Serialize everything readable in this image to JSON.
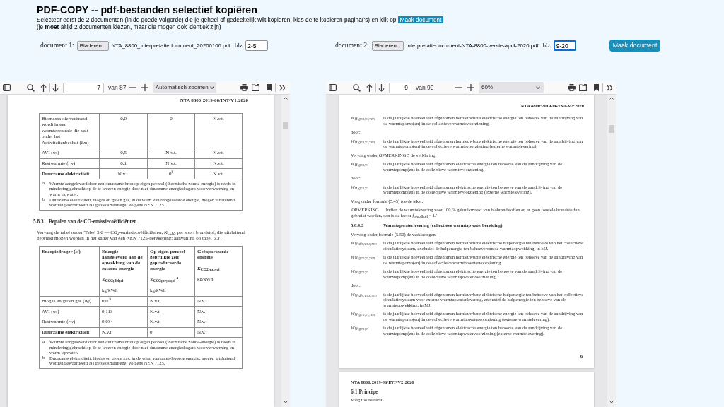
{
  "header": {
    "title": "PDF-COPY -- pdf-bestanden selectief kopiëren",
    "instruction": "Selecteer eerst de 2 documenten (in de goede volgorde) die je geheel of gedeeltelijk wilt kopiëren, kies de te kopiëren pagina('s) en klik op",
    "instruction_highlight": "Maak document",
    "note": "(je **moet** altijd 2 documenten kiezen, maar die mogen ook identiek zijn)"
  },
  "documents": [
    {
      "label": "document 1:",
      "browse_button": "Bladeren...",
      "filename": "NTA_8800_interpretatiedocument_20200106.pdf",
      "pages_label": "blz.",
      "pages": "2-5",
      "focused": false
    },
    {
      "label": "document 2:",
      "browse_button": "Bladeren...",
      "filename": "Interpretatiedocument-NTA-8800-versie-april-2020.pdf",
      "pages_label": "blz.",
      "pages": "9-20",
      "focused": true
    }
  ],
  "make_button": "Maak document",
  "viewers": [
    {
      "toolbar": {
        "page": "7",
        "page_count": "van 87",
        "zoom": "Automatisch zoomen"
      },
      "pages": [
        {
          "blocks": [
            {
              "kind": "running_header",
              "text": "NTA 8800:2019-06/INT-V1:2020"
            },
            {
              "kind": "table",
              "rows": [
                {
                  "cells": [
                    "Biomassa die verbrand wordt in een warmtecentrale die valt onder het Activiteitenbesluit (*bm*)",
                    "0,0",
                    "0",
                    "N.v.t."
                  ],
                  "label_bold": false
                },
                {
                  "cells": [
                    "AVI (*wi*)",
                    "0,5",
                    "N.v.t.",
                    "N.v.t."
                  ],
                  "label_bold": false
                },
                {
                  "cells": [
                    "Restwarmte (*rw*)",
                    "0,1",
                    "N.v.t.",
                    "N.v.t."
                  ],
                  "label_bold": false
                },
                {
                  "cells": [
                    "Duurzame elektriciteit",
                    "N.v.t.",
                    "0$^{b}$",
                    "N.v.t."
                  ],
                  "label_bold": true
                }
              ],
              "footnotes": [
                {
                  "mark": "a",
                  "text": "Warmte aangeleverd door een duurzame bron op eigen perceel (thermische zonne-energie) is reeds in mindering gebracht op de te leveren energie door niet-duurzame energiedragers voor verwarming en warm tapwater."
                },
                {
                  "mark": "b",
                  "text": "Duurzame elektriciteit, biogas en groen gas, in de vorm van aangeleverde energie, mogen uitsluitend worden gewaardeerd als gebiedsmaatregel volgens NEN 7125."
                }
              ]
            },
            {
              "kind": "heading",
              "number": "5.8.3",
              "text": "Bepalen van de CO-emissiecoëfficiënten"
            },
            {
              "kind": "paragraph",
              "text": "Vervang de tabel onder 'Tabel 5.6 — CO$_{2}$-emissiecoëfficiënten, *K*$_{CO2}$, per soort brandstof, die uitsluitend gebruikt mogen worden in het kader van een NEN 7125-berekening; aanvulling op tabel 5.3':"
            },
            {
              "kind": "table",
              "columns": [
                {
                  "title": "Energiedrager (*ci*)"
                },
                {
                  "title": "Energie aangeleverd aan de opwekking van de externe energie",
                  "symbol": "*K*$_{CO2;del;ci}$",
                  "unit": "kg/kWh"
                },
                {
                  "title": "Op eigen perceel gebruikte zelf geproduceerde energie",
                  "symbol": "*K*$_{CO2;pr;us;ci}$ $^{a}$",
                  "unit": "kg/kWh"
                },
                {
                  "title": "Geëxporteerde energie",
                  "symbol": "*K*$_{CO2;exp;ci}$",
                  "unit": "kg/kWh"
                }
              ],
              "rows": [
                {
                  "cells": [
                    "Biogas en groen gas (*bg*)",
                    "0,0 $^{b}$",
                    "N.v.t.",
                    "N.v.t."
                  ],
                  "label_bold": false
                },
                {
                  "cells": [
                    "AVI (*wi*)",
                    "0,113",
                    "N.v.t",
                    "N.v.t"
                  ],
                  "label_bold": false
                },
                {
                  "cells": [
                    "Restwarmte (*rw*)",
                    "0,034",
                    "N.v.t",
                    "N.v.t"
                  ],
                  "label_bold": false
                },
                {
                  "cells": [
                    "Duurzame elektriciteit",
                    "N.v.t",
                    "0",
                    "N.v.t"
                  ],
                  "label_bold": true
                }
              ],
              "footnotes": [
                {
                  "mark": "a",
                  "text": "Warmte aangeleverd door een duurzame bron op eigen perceel (thermische zonne-energie) is reeds in mindering gebracht op de te leveren energie door niet-duurzame energiedragers voor verwarming en warm tapwater."
                },
                {
                  "mark": "b",
                  "text": "Duurzame elektriciteit, biogas en groen gas, in de vorm van aangeleverde energie, mogen uitsluitend worden gewaardeerd als gebiedsmaatregel volgens NEN 7125."
                }
              ]
            }
          ]
        }
      ]
    },
    {
      "toolbar": {
        "page": "9",
        "page_count": "van 99",
        "zoom": "60%"
      },
      "pages": [
        {
          "blocks": [
            {
              "kind": "running_header",
              "text": "NTA 8800:2019-06/INT-V2:2020"
            },
            {
              "kind": "definition",
              "symbol": "W$_{H;gen;el;ren}$",
              "text": "is de jaarlijkse hoeveelheid afgenomen hernieuwbare elektrische energie ten behoeve van de aandrijving van de warmtepomp(en) in de collectieve warmtevoorziening."
            },
            {
              "kind": "paragraph",
              "text": "door:"
            },
            {
              "kind": "definition",
              "symbol": "W$_{H;gen;el;ren}$",
              "text": "is de jaarlijkse hoeveelheid afgenomen hernieuwbare elektrische energie ten behoeve van de aandrijving van de warmtepomp(en) in de collectieve warmtevoorziening (externe warmtelevering)."
            },
            {
              "kind": "paragraph",
              "text": "Vervang onder OPMERKING 5 de verklaring:"
            },
            {
              "kind": "definition",
              "symbol": "W$_{H;gen;el}$",
              "text": "is de jaarlijkse hoeveelheid afgenomen elektrische energie ten behoeve van de aandrijving van de warmtepomp(en) in de collectieve warmtevoorziening."
            },
            {
              "kind": "paragraph",
              "text": "door:"
            },
            {
              "kind": "definition",
              "symbol": "W$_{H;gen;el}$",
              "text": "is de jaarlijkse hoeveelheid afgenomen elektrische energie ten behoeve van de aandrijving van de warmtepomp(en) in de collectieve warmtevoorziening (externe warmtelevering)."
            },
            {
              "kind": "paragraph",
              "text": "Voeg onder formule (5.45) toe de tekst:"
            },
            {
              "kind": "note",
              "label": "'OPMERKING",
              "text": "Indien de warmtelevering voor 100 % gebruikmaakt van biobrandstoffen en er geen fossiele brandstoffen gebruikt worden, dan is de factor *f*$_{ren;dh;el}$ = 1.'"
            },
            {
              "kind": "heading",
              "number": "5.8.4.3",
              "text": "Warmtapwaterlevering (collectieve warmtapwaterbereiding)"
            },
            {
              "kind": "paragraph",
              "text": "Vervang onder formule (5.50) de verklaringen:"
            },
            {
              "kind": "definition",
              "symbol": "W$_{W;dis;aux;ren}$",
              "text": "is de jaarlijkse hoeveelheid afgenomen hernieuwbare elektrische hulpenergie ten behoeve van het collectieve circulatiesysteem, exclusief de hulpenergie ten behoeve van de warmteopwekking, in MJ."
            },
            {
              "kind": "definition",
              "symbol": "W$_{W;gen;el;ren}$",
              "text": "is de jaarlijkse hoeveelheid afgenomen hernieuwbare elektrische energie ten behoeve van de aandrijving van de warmtepomp(en) in de collectieve warmtapwatervoorziening."
            },
            {
              "kind": "definition",
              "symbol": "W$_{W;gen;el}$",
              "text": "is de jaarlijkse hoeveelheid afgenomen elektrische energie ten behoeve van de aandrijving van de warmtepomp(en) in de collectieve warmtapwatervoorziening."
            },
            {
              "kind": "paragraph",
              "text": "door:"
            },
            {
              "kind": "definition",
              "symbol": "W$_{W;dis;aux;ren}$",
              "text": "is de jaarlijkse hoeveelheid afgenomen hernieuwbare elektrische hulpenergie ten behoeve van het collectieve circulatiesysteem voor externe warmtapwaterlevering, exclusief de hulpenergie ten behoeve van de warmteopwekking, in MJ."
            },
            {
              "kind": "definition",
              "symbol": "W$_{W;gen;el;ren}$",
              "text": "is de jaarlijkse hoeveelheid afgenomen hernieuwbare elektrische energie ten behoeve van de aandrijving van de warmtepomp(en) in de collectieve warmtapwatervoorziening (externe warmtelevering)."
            },
            {
              "kind": "definition",
              "symbol": "W$_{W;gen;el}$",
              "text": "is de jaarlijkse hoeveelheid afgenomen elektrische energie ten behoeve van de aandrijving van de warmtepomp(en) in de collectieve warmtapwatervoorziening (externe warmtelevering)."
            },
            {
              "kind": "page_number",
              "text": "9"
            }
          ]
        },
        {
          "blocks": [
            {
              "kind": "running_header",
              "text": "NTA 8800:2019-06/INT-V2:2020"
            },
            {
              "kind": "title_heading",
              "number": "6.1",
              "text": "Principe"
            },
            {
              "kind": "paragraph",
              "text": "Voeg toe de tekst:"
            }
          ]
        }
      ]
    }
  ]
}
